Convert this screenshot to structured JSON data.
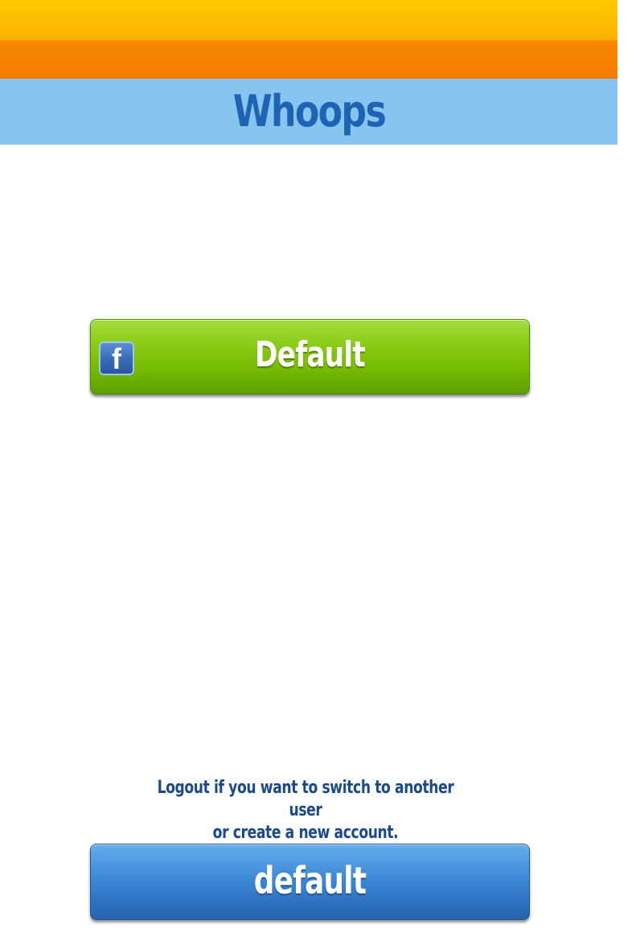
{
  "header": {
    "title": "Whoops"
  },
  "facebook_button": {
    "icon": "facebook-f-icon",
    "icon_glyph": "f",
    "label": "Default"
  },
  "logout": {
    "hint_line1": "Logout if you want to switch to another user",
    "hint_line2": "or create a new account.",
    "button_label": "default"
  },
  "colors": {
    "top_bar": "#f88800",
    "title_bar": "#87c4ef",
    "title_text": "#1e64b4",
    "facebook_button": "#7cc000",
    "logout_button": "#3d8ad8",
    "hint_text": "#1a4a8c"
  }
}
